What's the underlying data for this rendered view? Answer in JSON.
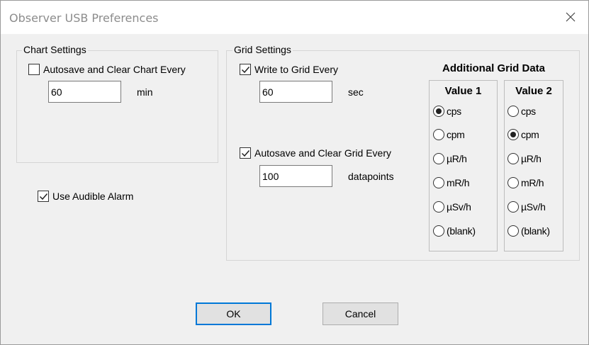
{
  "window": {
    "title": "Observer USB Preferences"
  },
  "chart_settings": {
    "group_title": "Chart Settings",
    "autosave_label": "Autosave and Clear Chart Every",
    "autosave_checked": false,
    "interval_value": "60",
    "interval_unit": "min"
  },
  "alarm": {
    "label": "Use Audible Alarm",
    "checked": true
  },
  "grid_settings": {
    "group_title": "Grid Settings",
    "write_label": "Write to Grid Every",
    "write_checked": true,
    "write_value": "60",
    "write_unit": "sec",
    "autosave_label": "Autosave and Clear Grid Every",
    "autosave_checked": true,
    "autosave_value": "100",
    "autosave_unit": "datapoints",
    "additional_heading": "Additional Grid Data",
    "value1": {
      "heading": "Value 1",
      "selected": "cps",
      "options": [
        "cps",
        "cpm",
        "µR/h",
        "mR/h",
        "µSv/h",
        "(blank)"
      ]
    },
    "value2": {
      "heading": "Value 2",
      "selected": "cpm",
      "options": [
        "cps",
        "cpm",
        "µR/h",
        "mR/h",
        "µSv/h",
        "(blank)"
      ]
    }
  },
  "buttons": {
    "ok_label": "OK",
    "cancel_label": "Cancel"
  },
  "colors": {
    "accent": "#0078d7",
    "title_text": "#8c8c8c",
    "face": "#f0f0f0"
  }
}
